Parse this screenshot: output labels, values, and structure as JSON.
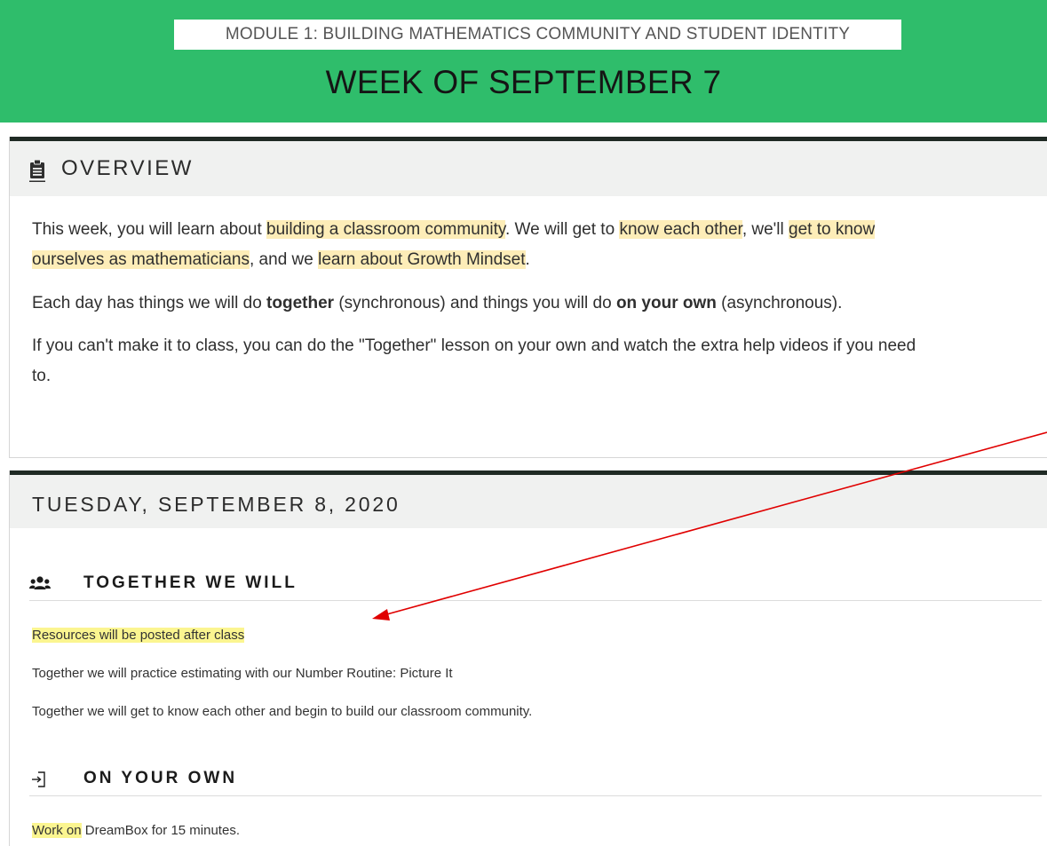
{
  "header": {
    "module_label": "MODULE 1: BUILDING MATHEMATICS COMMUNITY AND STUDENT IDENTITY",
    "week_title": "WEEK OF SEPTEMBER 7"
  },
  "overview": {
    "icon": "clipboard-icon",
    "title": "OVERVIEW",
    "p1": {
      "t1": "This week, you will learn about ",
      "h1": "building a classroom community",
      "t2": ". We will get to ",
      "h2": "know each other",
      "t3": ", we'll ",
      "h3a": "get to know",
      "h3b": "ourselves as mathematicians",
      "t4": ", and we ",
      "h4": "learn about Growth Mindset",
      "t5": "."
    },
    "p2": {
      "t1": "Each day has things we will do ",
      "b1": "together",
      "t2": " (synchronous) and things you will do ",
      "b2": "on your own",
      "t3": " (asynchronous)."
    },
    "p3": {
      "line1": "If you can't make it to class, you can do the \"Together\" lesson on your own and watch the extra help videos if you need",
      "line2": "to."
    }
  },
  "day": {
    "title": "TUESDAY, SEPTEMBER 8, 2020",
    "together": {
      "icon": "users-icon",
      "title": "TOGETHER WE WILL",
      "highlight": "Resources will be posted after class",
      "line1": "Together we will practice estimating with our Number Routine: Picture It",
      "line2": "Together we will get to know each other and begin to build our classroom community."
    },
    "on_your_own": {
      "icon": "sign-in-icon",
      "title": "ON YOUR OWN",
      "highlight": "Work on",
      "rest": " DreamBox for 15 minutes."
    }
  },
  "colors": {
    "banner": "#2fbd6b",
    "highlight_soft": "#fdedb8",
    "highlight_yellow": "#fbf590",
    "annotation_arrow": "#e00000"
  }
}
